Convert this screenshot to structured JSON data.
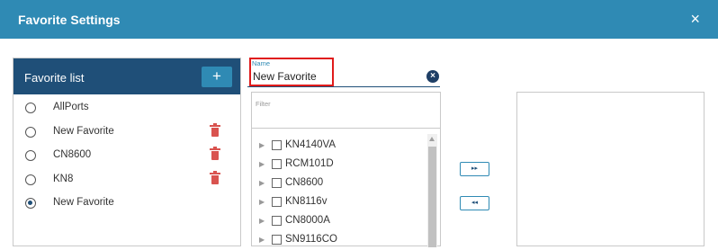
{
  "dialog": {
    "title": "Favorite Settings",
    "close_glyph": "×"
  },
  "favorite_list": {
    "header": "Favorite list",
    "add_glyph": "+",
    "items": [
      {
        "label": "AllPorts",
        "selected": false,
        "deletable": false
      },
      {
        "label": "New Favorite",
        "selected": false,
        "deletable": true
      },
      {
        "label": "CN8600",
        "selected": false,
        "deletable": true
      },
      {
        "label": "KN8",
        "selected": false,
        "deletable": true
      },
      {
        "label": "New Favorite",
        "selected": true,
        "deletable": false
      }
    ]
  },
  "name_field": {
    "label": "Name",
    "value": "New Favorite",
    "clear_glyph": "×",
    "highlight_color": "#e01b1b"
  },
  "filter": {
    "placeholder": "Filter"
  },
  "device_tree": {
    "items": [
      {
        "label": "KN4140VA"
      },
      {
        "label": "RCM101D"
      },
      {
        "label": "CN8600"
      },
      {
        "label": "KN8116v"
      },
      {
        "label": "CN8000A"
      },
      {
        "label": "SN9116CO"
      }
    ],
    "expand_glyph": "▶"
  },
  "move_buttons": {
    "add_glyph": "▸▸",
    "remove_glyph": "◂◂"
  },
  "colors": {
    "title_bar": "#2f8ab4",
    "panel_header": "#1f4f78",
    "delete": "#d9534f"
  }
}
